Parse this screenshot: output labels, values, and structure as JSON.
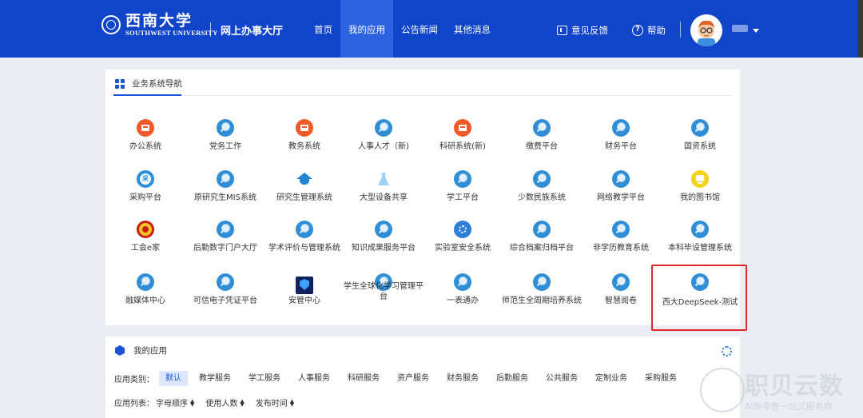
{
  "header": {
    "logo_cn": "西南大学",
    "logo_en": "SOUTHWEST UNIVERSITY",
    "portal_title": "网上办事大厅",
    "nav": [
      "首页",
      "我的应用",
      "公告新闻",
      "其他消息"
    ],
    "active_nav": "我的应用",
    "feedback_label": "意见反馈",
    "help_label": "帮助",
    "accent": "#1044c9"
  },
  "nav_panel": {
    "title": "业务系统导航",
    "apps": [
      {
        "label": "办公系统",
        "icon": "red-doc-icon"
      },
      {
        "label": "党务工作",
        "icon": "magnifier-bulb-icon"
      },
      {
        "label": "教务系统",
        "icon": "red-doc-icon"
      },
      {
        "label": "人事人才（新)",
        "icon": "magnifier-bulb-icon"
      },
      {
        "label": "科研系统(新)",
        "icon": "red-doc-icon"
      },
      {
        "label": "缴费平台",
        "icon": "magnifier-bulb-icon"
      },
      {
        "label": "财务平台",
        "icon": "magnifier-bulb-icon"
      },
      {
        "label": "国资系统",
        "icon": "magnifier-bulb-icon"
      },
      {
        "label": "采购平台",
        "icon": "purchase-icon"
      },
      {
        "label": "原研究生MIS系统",
        "icon": "magnifier-bulb-icon"
      },
      {
        "label": "研究生管理系统",
        "icon": "graduation-cap-icon"
      },
      {
        "label": "大型设备共享",
        "icon": "flask-icon"
      },
      {
        "label": "学工平台",
        "icon": "magnifier-bulb-icon"
      },
      {
        "label": "少数民族系统",
        "icon": "magnifier-bulb-icon"
      },
      {
        "label": "网络教学平台",
        "icon": "magnifier-bulb-icon"
      },
      {
        "label": "我的图书馆",
        "icon": "library-icon"
      },
      {
        "label": "工会e家",
        "icon": "union-emblem-icon"
      },
      {
        "label": "后勤数字门户大厅",
        "icon": "magnifier-bulb-icon"
      },
      {
        "label": "学术评价与管理系统",
        "icon": "magnifier-bulb-icon"
      },
      {
        "label": "知识成果服务平台",
        "icon": "magnifier-bulb-icon"
      },
      {
        "label": "实验室安全系统",
        "icon": "gear-icon"
      },
      {
        "label": "综合档案归档平台",
        "icon": "magnifier-bulb-icon"
      },
      {
        "label": "非学历教育系统",
        "icon": "magnifier-bulb-icon"
      },
      {
        "label": "本科毕设管理系统",
        "icon": "magnifier-bulb-icon"
      },
      {
        "label": "融媒体中心",
        "icon": "magnifier-bulb-icon"
      },
      {
        "label": "可信电子凭证平台",
        "icon": "magnifier-bulb-icon"
      },
      {
        "label": "安管中心",
        "icon": "shield-icon"
      },
      {
        "label": "学生全球化学习管理平台",
        "icon": "magnifier-bulb-icon"
      },
      {
        "label": "一表通办",
        "icon": "magnifier-bulb-icon"
      },
      {
        "label": "师范生全周期培养系统",
        "icon": "magnifier-bulb-icon"
      },
      {
        "label": "智慧阅卷",
        "icon": "magnifier-bulb-icon"
      },
      {
        "label": "西大DeepSeek-测试",
        "icon": "magnifier-bulb-icon"
      }
    ],
    "highlight_color": "#e0262d"
  },
  "my_apps": {
    "title": "我的应用",
    "category_label": "应用类别：",
    "categories": [
      "默认",
      "教学服务",
      "学工服务",
      "人事服务",
      "科研服务",
      "资产服务",
      "财务服务",
      "后勤服务",
      "公共服务",
      "定制业务",
      "采购服务"
    ],
    "active_category": "默认",
    "list_label": "应用列表：",
    "sorts": [
      "字母顺序",
      "使用人数",
      "发布时间"
    ]
  },
  "watermark": {
    "title": "职贝云数",
    "subtitle": "AI新零售一站式服务商"
  }
}
